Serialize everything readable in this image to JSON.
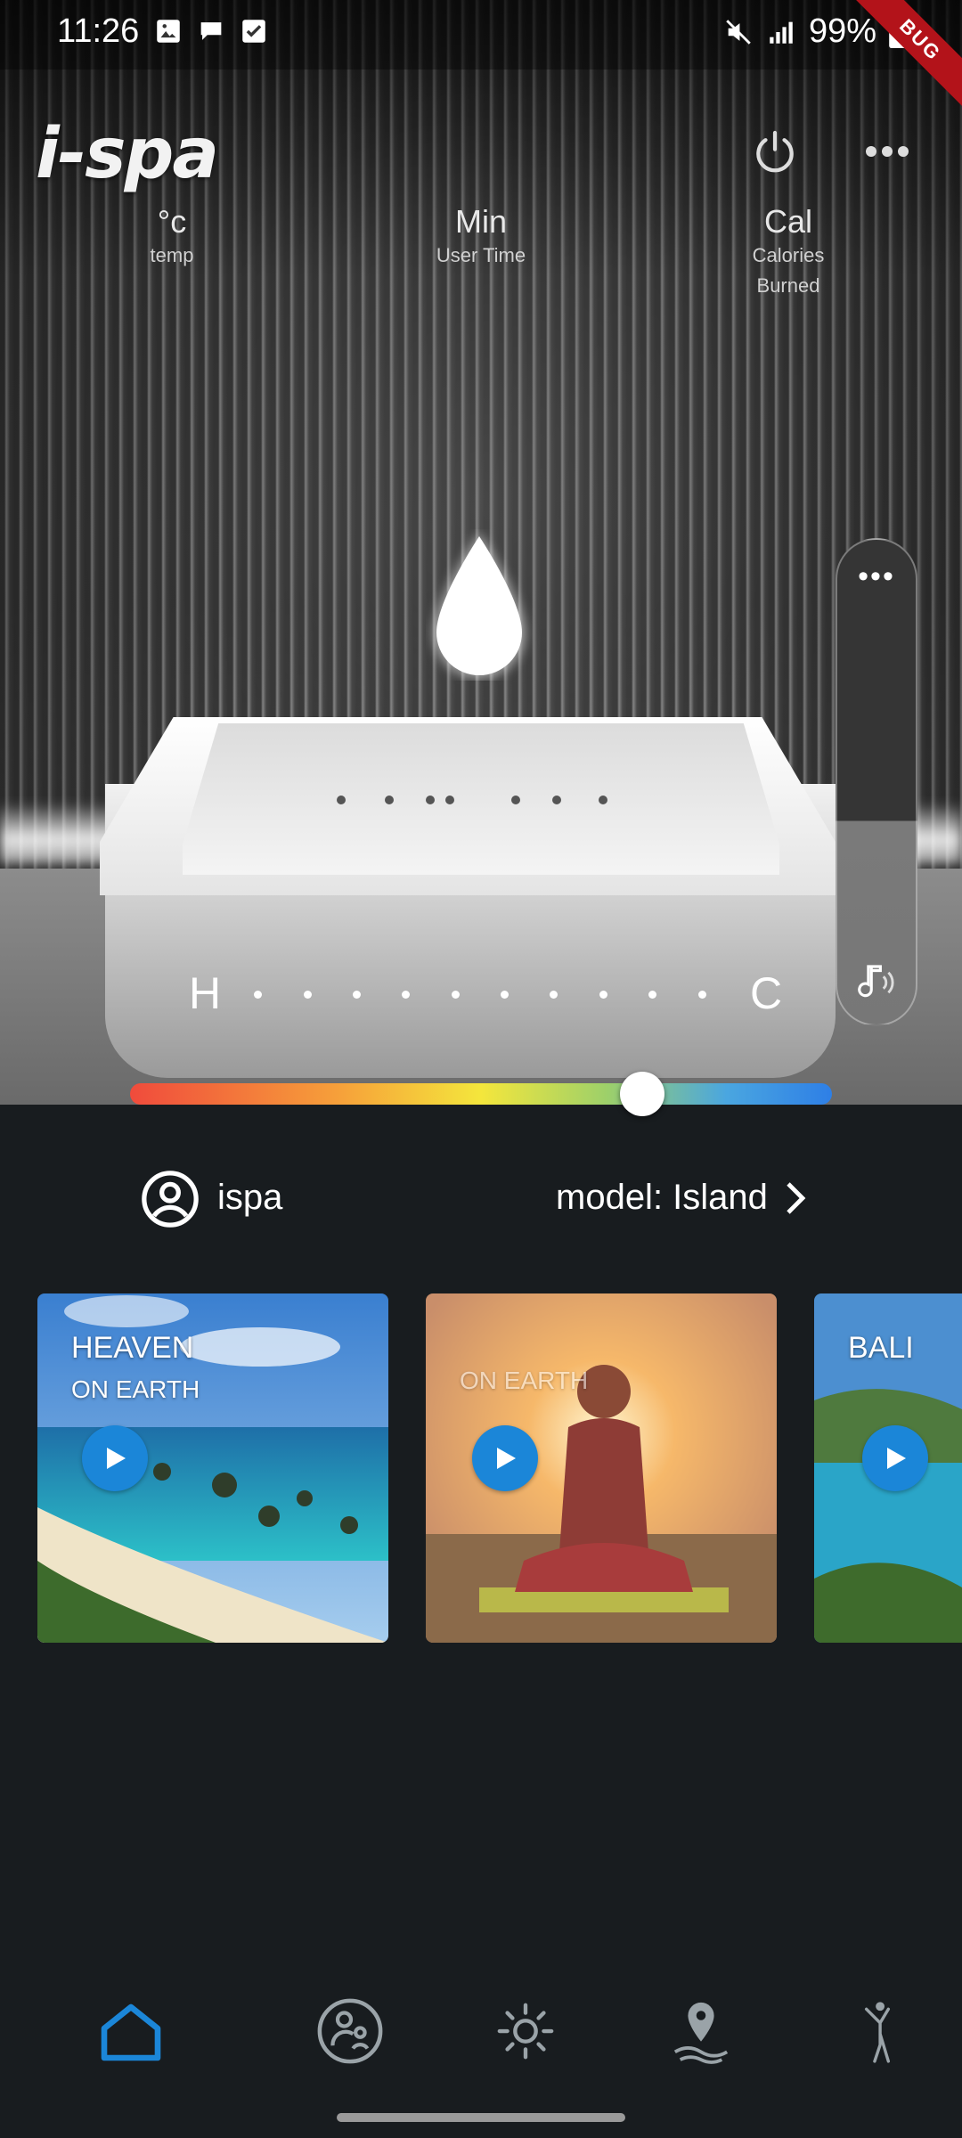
{
  "status_bar": {
    "time": "11:26",
    "battery": "99%",
    "debug_banner": "BUG",
    "icons": [
      "image-icon",
      "chat-icon",
      "checkbox-icon",
      "mute-icon",
      "signal-icon",
      "battery-icon"
    ]
  },
  "header": {
    "logo": "i-spa",
    "power_icon": "power-icon",
    "more_icon": "more-horizontal-icon"
  },
  "stats": [
    {
      "unit": "°c",
      "label": "temp"
    },
    {
      "unit": "Min",
      "label": "User Time"
    },
    {
      "unit": "Cal",
      "label": "Calories Burned"
    }
  ],
  "temperature_scale": {
    "hot_label": "H",
    "cold_label": "C",
    "slider_position": 0.73
  },
  "side_panel": {
    "menu": "•••",
    "music_icon": "music-note-icon"
  },
  "user": {
    "name": "ispa",
    "model_label": "model: Island"
  },
  "cards": [
    {
      "title": "HEAVEN",
      "subtitle": "ON EARTH"
    },
    {
      "title": "",
      "subtitle": "ON EARTH"
    },
    {
      "title": "BALI",
      "subtitle": ""
    }
  ],
  "bottom_nav": [
    {
      "icon": "home-icon",
      "active": true
    },
    {
      "icon": "family-icon",
      "active": false
    },
    {
      "icon": "sun-icon",
      "active": false
    },
    {
      "icon": "location-pin-icon",
      "active": false
    },
    {
      "icon": "figure-icon",
      "active": false
    }
  ],
  "colors": {
    "background": "#181c1f",
    "accent": "#1b86d8",
    "play_button": "#1b86d8"
  }
}
